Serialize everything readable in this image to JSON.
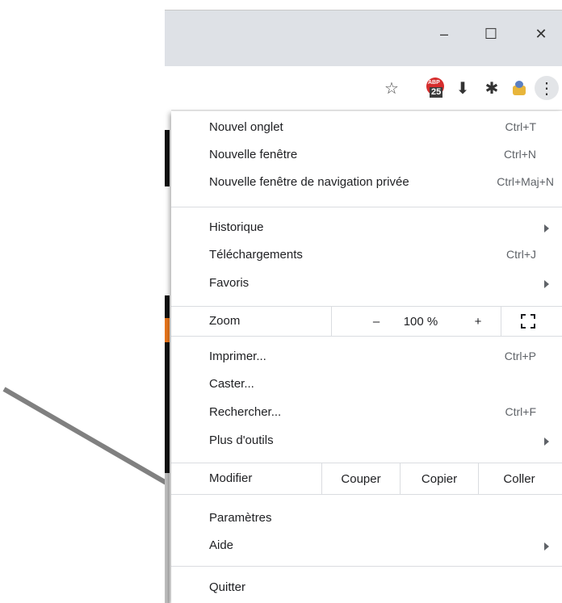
{
  "window": {
    "minimize_glyph": "–",
    "maximize_glyph": "☐",
    "close_glyph": "✕"
  },
  "toolbar": {
    "star_glyph": "☆",
    "abp_badge_top": "ABP",
    "abp_badge_count": "25",
    "download_glyph": "⬇",
    "puzzle_glyph": "✱",
    "kebab_glyph": "⋮"
  },
  "menu": {
    "items_group1": [
      {
        "label": "Nouvel onglet",
        "shortcut": "Ctrl+T"
      },
      {
        "label": "Nouvelle fenêtre",
        "shortcut": "Ctrl+N"
      },
      {
        "label": "Nouvelle fenêtre de navigation privée",
        "shortcut": "Ctrl+Maj+N"
      }
    ],
    "items_group2": [
      {
        "label": "Historique",
        "shortcut": ""
      },
      {
        "label": "Téléchargements",
        "shortcut": "Ctrl+J"
      },
      {
        "label": "Favoris",
        "shortcut": ""
      }
    ],
    "zoom": {
      "label": "Zoom",
      "minus": "–",
      "level": "100 %",
      "plus": "+"
    },
    "items_group3": [
      {
        "label": "Imprimer...",
        "shortcut": "Ctrl+P"
      },
      {
        "label": "Caster...",
        "shortcut": ""
      },
      {
        "label": "Rechercher...",
        "shortcut": "Ctrl+F"
      },
      {
        "label": "Plus d'outils",
        "shortcut": ""
      }
    ],
    "edit": {
      "label": "Modifier",
      "cut": "Couper",
      "copy": "Copier",
      "paste": "Coller"
    },
    "items_group4": [
      {
        "label": "Paramètres",
        "shortcut": ""
      },
      {
        "label": "Aide",
        "shortcut": ""
      }
    ],
    "quit": {
      "label": "Quitter"
    }
  },
  "colors": {
    "title_bar": "#dee1e6",
    "arrow": "#808080",
    "abp_red": "#d62d2d"
  }
}
